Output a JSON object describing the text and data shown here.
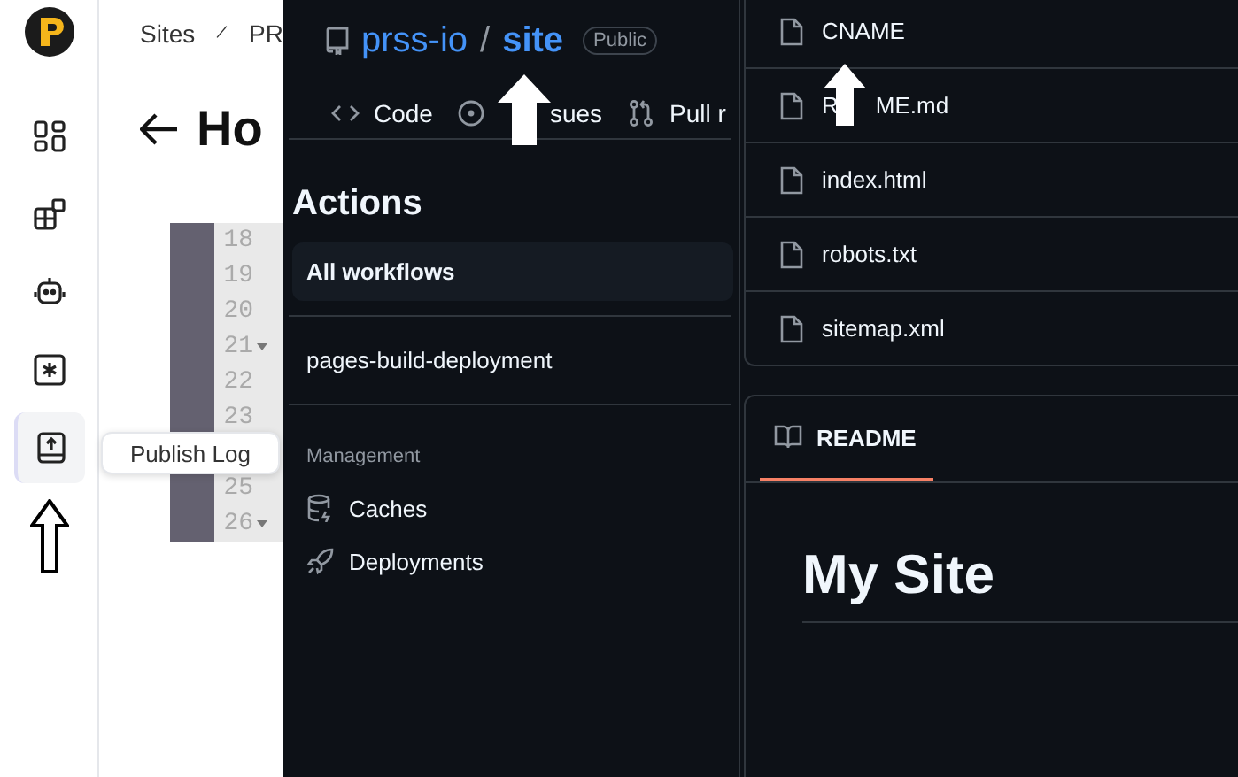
{
  "prss": {
    "nav": [
      {
        "kind": "dashboard",
        "selected": false
      },
      {
        "kind": "addons",
        "selected": false
      },
      {
        "kind": "robot",
        "selected": false
      },
      {
        "kind": "asterisk",
        "selected": false
      },
      {
        "kind": "publish",
        "selected": true
      }
    ],
    "tooltip": "Publish Log",
    "breadcrumb": [
      "Sites",
      "PR"
    ],
    "heading": "Ho",
    "line_numbers": [
      {
        "number": "18",
        "foldable": false
      },
      {
        "number": "19",
        "foldable": false
      },
      {
        "number": "20",
        "foldable": false
      },
      {
        "number": "21",
        "foldable": true
      },
      {
        "number": "22",
        "foldable": false
      },
      {
        "number": "23",
        "foldable": false
      },
      {
        "number": "25",
        "foldable": false
      },
      {
        "number": "26",
        "foldable": true
      }
    ]
  },
  "repo": {
    "owner": "prss-io",
    "separator": "/",
    "name": "site",
    "visibility": "Public",
    "tabs": [
      {
        "kind": "code",
        "label": "Code"
      },
      {
        "kind": "issues",
        "label": "sues"
      },
      {
        "kind": "pulls",
        "label": "Pull r"
      }
    ]
  },
  "actions": {
    "title": "Actions",
    "workflows": [
      {
        "label": "All workflows",
        "selected": true
      },
      {
        "label": "pages-build-deployment",
        "selected": false
      }
    ],
    "section": "Management",
    "items": [
      {
        "kind": "caches",
        "label": "Caches"
      },
      {
        "kind": "deployments",
        "label": "Deployments"
      }
    ]
  },
  "files": [
    {
      "name": "CNAME"
    },
    {
      "name": "R",
      "name_rest": "ME.md"
    },
    {
      "name": "index.html"
    },
    {
      "name": "robots.txt"
    },
    {
      "name": "sitemap.xml"
    }
  ],
  "readme": {
    "tab": "README",
    "heading": "My Site"
  }
}
